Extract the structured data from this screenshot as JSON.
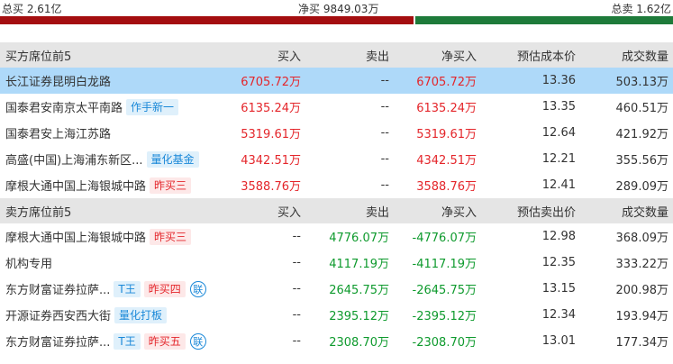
{
  "summary": {
    "total_buy": "总买 2.61亿",
    "net_buy": "净买 9849.03万",
    "total_sell": "总卖 1.62亿"
  },
  "colors": {
    "buy": "#e4262b",
    "sell": "#0e9a2d",
    "highlight": "#aed9f9"
  },
  "buy_header": {
    "title": "买方席位前5",
    "buy": "买入",
    "sell": "卖出",
    "net": "净买入",
    "price": "预估成本价",
    "volume": "成交数量"
  },
  "buy_rows": [
    {
      "name": "长江证券昆明白龙路",
      "tags": [],
      "buy": "6705.72万",
      "sell": "--",
      "net": "6705.72万",
      "price": "13.36",
      "volume": "503.13万"
    },
    {
      "name": "国泰君安南京太平南路",
      "tags": [
        {
          "text": "作手新一",
          "style": "blue"
        }
      ],
      "buy": "6135.24万",
      "sell": "--",
      "net": "6135.24万",
      "price": "13.35",
      "volume": "460.51万"
    },
    {
      "name": "国泰君安上海江苏路",
      "tags": [],
      "buy": "5319.61万",
      "sell": "--",
      "net": "5319.61万",
      "price": "12.64",
      "volume": "421.92万"
    },
    {
      "name": "高盛(中国)上海浦东新区...",
      "tags": [
        {
          "text": "量化基金",
          "style": "blue"
        }
      ],
      "buy": "4342.51万",
      "sell": "--",
      "net": "4342.51万",
      "price": "12.21",
      "volume": "355.56万"
    },
    {
      "name": "摩根大通中国上海银城中路",
      "tags": [
        {
          "text": "昨买三",
          "style": "red"
        }
      ],
      "buy": "3588.76万",
      "sell": "--",
      "net": "3588.76万",
      "price": "12.41",
      "volume": "289.09万"
    }
  ],
  "sell_header": {
    "title": "卖方席位前5",
    "buy": "买入",
    "sell": "卖出",
    "net": "净买入",
    "price": "预估卖出价",
    "volume": "成交数量"
  },
  "sell_rows": [
    {
      "name": "摩根大通中国上海银城中路",
      "tags": [
        {
          "text": "昨买三",
          "style": "red"
        }
      ],
      "buy": "--",
      "sell": "4776.07万",
      "net": "-4776.07万",
      "price": "12.98",
      "volume": "368.09万"
    },
    {
      "name": "机构专用",
      "tags": [],
      "buy": "--",
      "sell": "4117.19万",
      "net": "-4117.19万",
      "price": "12.35",
      "volume": "333.22万"
    },
    {
      "name": "东方财富证券拉萨...",
      "tags": [
        {
          "text": "T王",
          "style": "blue"
        },
        {
          "text": "昨买四",
          "style": "red"
        },
        {
          "text": "联",
          "style": "circle"
        }
      ],
      "buy": "--",
      "sell": "2645.75万",
      "net": "-2645.75万",
      "price": "13.15",
      "volume": "200.98万"
    },
    {
      "name": "开源证券西安西大街",
      "tags": [
        {
          "text": "量化打板",
          "style": "blue"
        }
      ],
      "buy": "--",
      "sell": "2395.12万",
      "net": "-2395.12万",
      "price": "12.34",
      "volume": "193.94万"
    },
    {
      "name": "东方财富证券拉萨...",
      "tags": [
        {
          "text": "T王",
          "style": "blue"
        },
        {
          "text": "昨买五",
          "style": "red"
        },
        {
          "text": "联",
          "style": "circle"
        }
      ],
      "buy": "--",
      "sell": "2308.70万",
      "net": "-2308.70万",
      "price": "13.01",
      "volume": "177.34万"
    }
  ]
}
